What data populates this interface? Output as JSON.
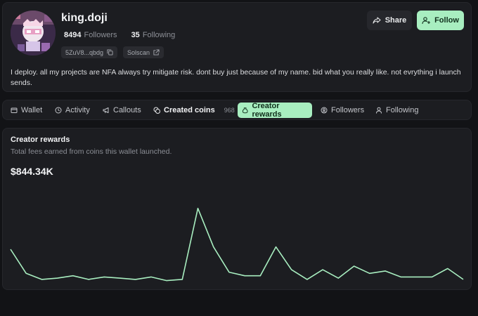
{
  "profile": {
    "name": "king.doji",
    "followers_count": "8494",
    "followers_label": "Followers",
    "following_count": "35",
    "following_label": "Following",
    "wallet_short": "5ZuV8...qbdg",
    "solscan_label": "Solscan",
    "bio": "I deploy. all my projects are NFA always try mitigate risk. dont buy just because of my name. bid what you really like. not evrything i launch sends.",
    "share_label": "Share",
    "follow_label": "Follow"
  },
  "tabs": [
    {
      "label": "Wallet",
      "icon": "wallet-icon"
    },
    {
      "label": "Activity",
      "icon": "clock-icon"
    },
    {
      "label": "Callouts",
      "icon": "megaphone-icon"
    },
    {
      "label": "Created coins",
      "icon": "coins-icon",
      "count": "968"
    },
    {
      "label": "Creator rewards",
      "icon": "reward-icon",
      "active": true
    },
    {
      "label": "Followers",
      "icon": "user-circle-icon"
    },
    {
      "label": "Following",
      "icon": "user-icon"
    }
  ],
  "rewards": {
    "title": "Creator rewards",
    "subtitle": "Total fees earned from coins this wallet launched.",
    "total": "$844.34K"
  },
  "colors": {
    "accent": "#a8eec0",
    "line": "#a8eec0"
  },
  "chart_data": {
    "type": "line",
    "title": "",
    "xlabel": "",
    "ylabel": "",
    "grid": false,
    "legend": "none",
    "x": [
      1,
      2,
      3,
      4,
      5,
      6,
      7,
      8,
      9,
      10,
      11,
      12,
      13,
      14,
      15,
      16,
      17,
      18,
      19,
      20,
      21,
      22,
      23,
      24,
      25,
      26,
      27,
      28,
      29,
      30
    ],
    "series": [
      {
        "values": [
          28,
          8,
          3,
          4,
          6,
          3,
          5,
          4,
          3,
          5,
          2,
          3,
          62,
          30,
          9,
          6,
          6,
          30,
          11,
          3,
          11,
          4,
          14,
          8,
          10,
          5,
          5,
          5,
          12,
          3
        ]
      }
    ],
    "ylim": [
      0,
      70
    ]
  }
}
